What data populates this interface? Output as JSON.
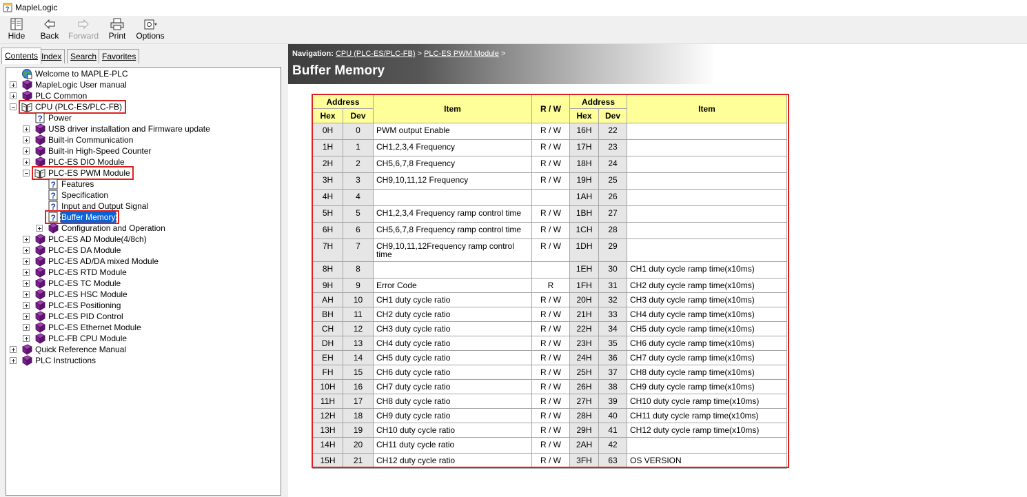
{
  "window": {
    "title": "MapleLogic"
  },
  "toolbar": {
    "hide": "Hide",
    "back": "Back",
    "forward": "Forward",
    "print": "Print",
    "options": "Options"
  },
  "tabs": [
    "Contents",
    "Index",
    "Search",
    "Favorites"
  ],
  "tree": [
    {
      "label": "Welcome to MAPLE-PLC",
      "level": 0,
      "icon": "globe-icon",
      "exp": null
    },
    {
      "label": "MapleLogic User manual",
      "level": 0,
      "icon": "book-icon",
      "exp": "plus"
    },
    {
      "label": "PLC Common",
      "level": 0,
      "icon": "book-icon",
      "exp": "plus"
    },
    {
      "label": "CPU (PLC-ES/PLC-FB)",
      "level": 0,
      "icon": "open-book-icon",
      "exp": "minus",
      "highlight": true
    },
    {
      "label": "Power",
      "level": 1,
      "icon": "help-page-icon",
      "exp": null
    },
    {
      "label": "USB driver installation and Firmware update",
      "level": 1,
      "icon": "book-icon",
      "exp": "plus"
    },
    {
      "label": "Built-in Communication",
      "level": 1,
      "icon": "book-icon",
      "exp": "plus"
    },
    {
      "label": "Built-in High-Speed Counter",
      "level": 1,
      "icon": "book-icon",
      "exp": "plus"
    },
    {
      "label": "PLC-ES DIO Module",
      "level": 1,
      "icon": "book-icon",
      "exp": "plus"
    },
    {
      "label": "PLC-ES PWM Module",
      "level": 1,
      "icon": "open-book-icon",
      "exp": "minus",
      "highlight": true
    },
    {
      "label": "Features",
      "level": 2,
      "icon": "help-page-icon",
      "exp": null
    },
    {
      "label": "Specification",
      "level": 2,
      "icon": "help-page-icon",
      "exp": null
    },
    {
      "label": "Input and Output Signal",
      "level": 2,
      "icon": "help-page-icon",
      "exp": null
    },
    {
      "label": "Buffer Memory",
      "level": 2,
      "icon": "help-page-icon",
      "exp": null,
      "selected": true,
      "highlight": true
    },
    {
      "label": "Configuration and Operation",
      "level": 2,
      "icon": "book-icon",
      "exp": "plus"
    },
    {
      "label": "PLC-ES AD Module(4/8ch)",
      "level": 1,
      "icon": "book-icon",
      "exp": "plus"
    },
    {
      "label": "PLC-ES DA Module",
      "level": 1,
      "icon": "book-icon",
      "exp": "plus"
    },
    {
      "label": "PLC-ES AD/DA mixed Module",
      "level": 1,
      "icon": "book-icon",
      "exp": "plus"
    },
    {
      "label": "PLC-ES RTD Module",
      "level": 1,
      "icon": "book-icon",
      "exp": "plus"
    },
    {
      "label": "PLC-ES TC Module",
      "level": 1,
      "icon": "book-icon",
      "exp": "plus"
    },
    {
      "label": "PLC-ES HSC Module",
      "level": 1,
      "icon": "book-icon",
      "exp": "plus"
    },
    {
      "label": "PLC-ES Positioning",
      "level": 1,
      "icon": "book-icon",
      "exp": "plus"
    },
    {
      "label": "PLC-ES PID Control",
      "level": 1,
      "icon": "book-icon",
      "exp": "plus"
    },
    {
      "label": "PLC-ES Ethernet Module",
      "level": 1,
      "icon": "book-icon",
      "exp": "plus"
    },
    {
      "label": "PLC-FB CPU Module",
      "level": 1,
      "icon": "book-icon",
      "exp": "plus"
    },
    {
      "label": "Quick Reference Manual",
      "level": 0,
      "icon": "book-icon",
      "exp": "plus"
    },
    {
      "label": "PLC Instructions",
      "level": 0,
      "icon": "book-icon",
      "exp": "plus"
    }
  ],
  "navigation": {
    "prefix": "Navigation:",
    "crumbs": [
      "CPU (PLC-ES/PLC-FB)",
      "PLC-ES PWM Module"
    ],
    "separator": ">"
  },
  "page": {
    "title": "Buffer Memory"
  },
  "table": {
    "headers": {
      "address": "Address",
      "hex": "Hex",
      "dev": "Dev",
      "item": "Item",
      "rw": "R / W"
    },
    "rows": [
      {
        "hex1": "0H",
        "dev1": "0",
        "item1": "PWM output Enable",
        "rw": "R / W",
        "hex2": "16H",
        "dev2": "22",
        "item2": ""
      },
      {
        "hex1": "1H",
        "dev1": "1",
        "item1": "CH1,2,3,4 Frequency",
        "rw": "R / W",
        "hex2": "17H",
        "dev2": "23",
        "item2": ""
      },
      {
        "hex1": "2H",
        "dev1": "2",
        "item1": "CH5,6,7,8 Frequency",
        "rw": "R / W",
        "hex2": "18H",
        "dev2": "24",
        "item2": ""
      },
      {
        "hex1": "3H",
        "dev1": "3",
        "item1": "CH9,10,11,12 Frequency",
        "rw": "R / W",
        "hex2": "19H",
        "dev2": "25",
        "item2": ""
      },
      {
        "hex1": "4H",
        "dev1": "4",
        "item1": "",
        "rw": "",
        "hex2": "1AH",
        "dev2": "26",
        "item2": ""
      },
      {
        "hex1": "5H",
        "dev1": "5",
        "item1": "CH1,2,3,4 Frequency ramp control time",
        "rw": "R / W",
        "hex2": "1BH",
        "dev2": "27",
        "item2": ""
      },
      {
        "hex1": "6H",
        "dev1": "6",
        "item1": "CH5,6,7,8 Frequency ramp control time",
        "rw": "R / W",
        "hex2": "1CH",
        "dev2": "28",
        "item2": ""
      },
      {
        "hex1": "7H",
        "dev1": "7",
        "item1": "CH9,10,11,12Frequency ramp control time",
        "rw": "R / W",
        "hex2": "1DH",
        "dev2": "29",
        "item2": ""
      },
      {
        "hex1": "8H",
        "dev1": "8",
        "item1": "",
        "rw": "",
        "hex2": "1EH",
        "dev2": "30",
        "item2": "CH1 duty cycle ramp time(x10ms)"
      },
      {
        "hex1": "9H",
        "dev1": "9",
        "item1": "Error Code",
        "rw": "R",
        "hex2": "1FH",
        "dev2": "31",
        "item2": "CH2 duty cycle ramp time(x10ms)"
      },
      {
        "hex1": "AH",
        "dev1": "10",
        "item1": "CH1 duty cycle ratio",
        "rw": "R / W",
        "hex2": "20H",
        "dev2": "32",
        "item2": "CH3 duty cycle ramp time(x10ms)"
      },
      {
        "hex1": "BH",
        "dev1": "11",
        "item1": "CH2 duty cycle ratio",
        "rw": "R / W",
        "hex2": "21H",
        "dev2": "33",
        "item2": "CH4 duty cycle ramp time(x10ms)"
      },
      {
        "hex1": "CH",
        "dev1": "12",
        "item1": "CH3 duty cycle ratio",
        "rw": "R / W",
        "hex2": "22H",
        "dev2": "34",
        "item2": "CH5 duty cycle ramp time(x10ms)"
      },
      {
        "hex1": "DH",
        "dev1": "13",
        "item1": "CH4 duty cycle ratio",
        "rw": "R / W",
        "hex2": "23H",
        "dev2": "35",
        "item2": "CH6 duty cycle ramp time(x10ms)"
      },
      {
        "hex1": "EH",
        "dev1": "14",
        "item1": "CH5 duty cycle ratio",
        "rw": "R / W",
        "hex2": "24H",
        "dev2": "36",
        "item2": "CH7 duty cycle ramp time(x10ms)"
      },
      {
        "hex1": "FH",
        "dev1": "15",
        "item1": "CH6 duty cycle ratio",
        "rw": "R / W",
        "hex2": "25H",
        "dev2": "37",
        "item2": "CH8 duty cycle ramp time(x10ms)"
      },
      {
        "hex1": "10H",
        "dev1": "16",
        "item1": "CH7 duty cycle ratio",
        "rw": "R / W",
        "hex2": "26H",
        "dev2": "38",
        "item2": "CH9 duty cycle ramp time(x10ms)"
      },
      {
        "hex1": "11H",
        "dev1": "17",
        "item1": "CH8 duty cycle ratio",
        "rw": "R / W",
        "hex2": "27H",
        "dev2": "39",
        "item2": "CH10 duty cycle ramp time(x10ms)"
      },
      {
        "hex1": "12H",
        "dev1": "18",
        "item1": "CH9 duty cycle ratio",
        "rw": "R / W",
        "hex2": "28H",
        "dev2": "40",
        "item2": "CH11 duty cycle ramp time(x10ms)"
      },
      {
        "hex1": "13H",
        "dev1": "19",
        "item1": "CH10 duty cycle ratio",
        "rw": "R / W",
        "hex2": "29H",
        "dev2": "41",
        "item2": "CH12 duty cycle ramp time(x10ms)"
      },
      {
        "hex1": "14H",
        "dev1": "20",
        "item1": "CH11 duty cycle ratio",
        "rw": "R / W",
        "hex2": "2AH",
        "dev2": "42",
        "item2": ""
      },
      {
        "hex1": "15H",
        "dev1": "21",
        "item1": "CH12 duty cycle ratio",
        "rw": "R / W",
        "hex2": "3FH",
        "dev2": "63",
        "item2": "OS VERSION"
      }
    ]
  },
  "colors": {
    "highlight_border": "#e0201c",
    "table_header_bg": "#ffff99",
    "address_cell_bg": "#e6e6e6",
    "selection_bg": "#0a63d6",
    "book_icon": "#7a1f8c"
  }
}
